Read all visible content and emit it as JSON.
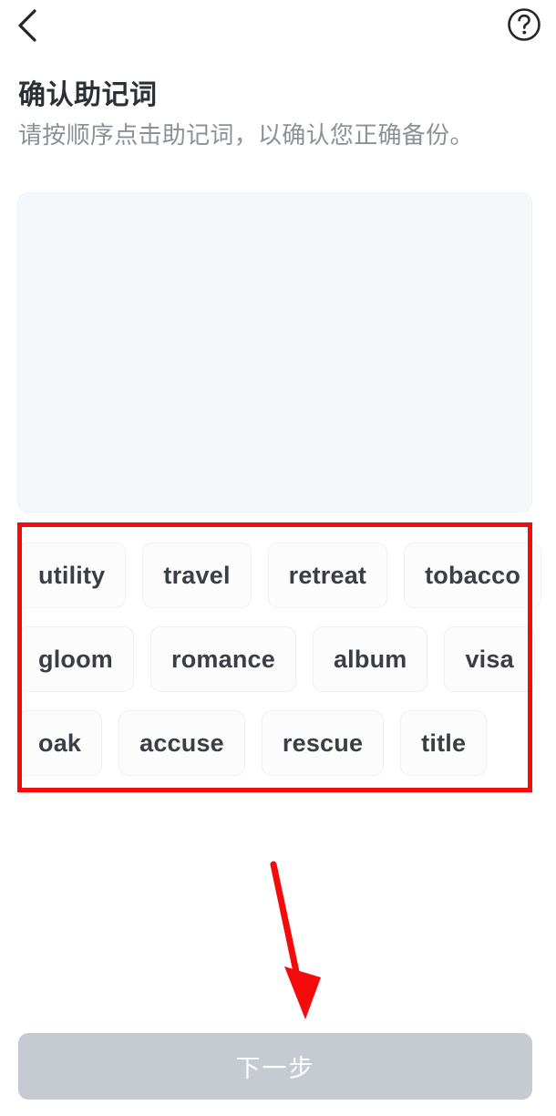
{
  "nav": {
    "back_icon": "chevron-left-icon",
    "help_icon": "question-circle-icon"
  },
  "header": {
    "title": "确认助记词",
    "subtitle": "请按顺序点击助记词，以确认您正确备份。"
  },
  "answer_panel": {
    "selected_words": [],
    "background_color": "#f5f8fb"
  },
  "word_bank": {
    "rows": [
      [
        "utility",
        "travel",
        "retreat",
        "tobacco"
      ],
      [
        "gloom",
        "romance",
        "album",
        "visa"
      ],
      [
        "oak",
        "accuse",
        "rescue",
        "title"
      ]
    ],
    "words": [
      "utility",
      "travel",
      "retreat",
      "tobacco",
      "gloom",
      "romance",
      "album",
      "visa",
      "oak",
      "accuse",
      "rescue",
      "title"
    ]
  },
  "footer": {
    "next_label": "下一步",
    "next_enabled": false,
    "next_color": "#c6cad1"
  },
  "annotations": {
    "highlight_color": "#f40b0b",
    "box_target": "word-bank",
    "arrow_target": "next-button"
  }
}
